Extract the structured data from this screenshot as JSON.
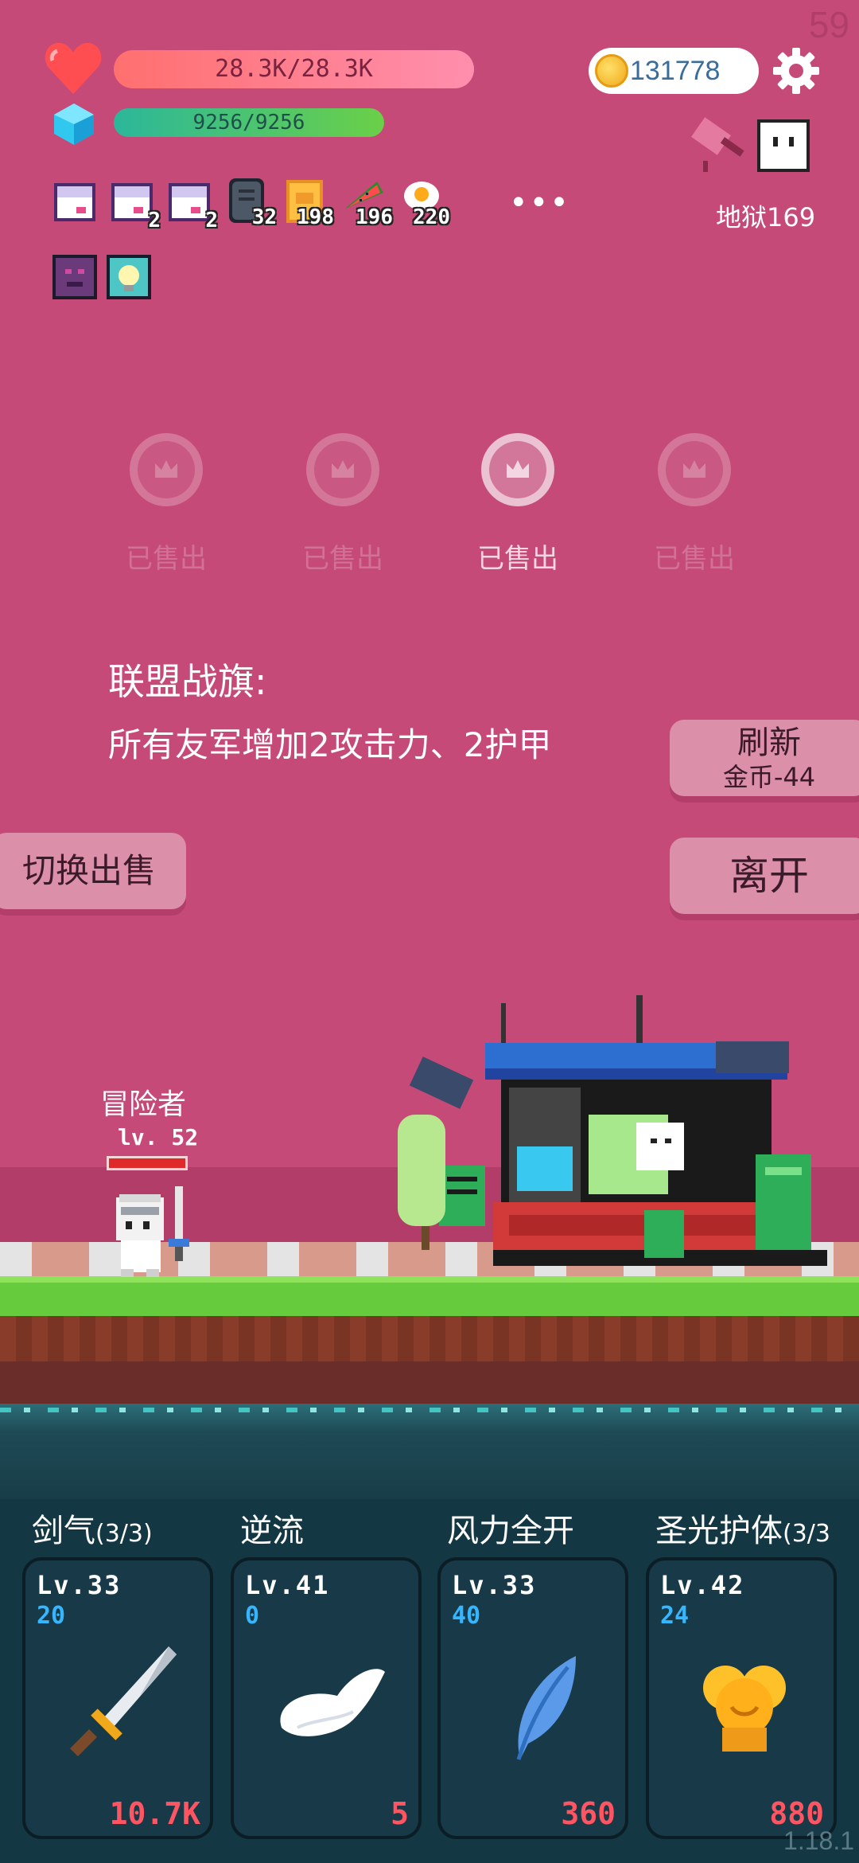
{
  "fps": "59",
  "stats": {
    "hp": "28.3K/28.3K",
    "mp": "9256/9256",
    "coins": "131778"
  },
  "location": "地狱169",
  "inventory": [
    {
      "icon": "mailbox-ribbon-icon",
      "count": ""
    },
    {
      "icon": "mailbox-ribbon-icon",
      "count": "2"
    },
    {
      "icon": "mailbox-ribbon-icon",
      "count": "2"
    },
    {
      "icon": "stone-tablet-icon",
      "count": "32"
    },
    {
      "icon": "spellbook-icon",
      "count": "198"
    },
    {
      "icon": "watermelon-icon",
      "count": "196"
    },
    {
      "icon": "fried-egg-icon",
      "count": "220"
    }
  ],
  "more_label": "•••",
  "buffs": [
    "demon-buff-icon",
    "lightbulb-buff-icon"
  ],
  "shop": {
    "slots": [
      {
        "label": "已售出",
        "active": false
      },
      {
        "label": "已售出",
        "active": false
      },
      {
        "label": "已售出",
        "active": true
      },
      {
        "label": "已售出",
        "active": false
      }
    ],
    "item_title": "联盟战旗:",
    "item_desc": "所有友军增加2攻击力、2护甲",
    "refresh_label": "刷新",
    "refresh_cost": "金币-44",
    "switch_label": "切换出售",
    "leave_label": "离开"
  },
  "player": {
    "name": "冒险者",
    "level": "lv. 52",
    "hp_fraction": 1.0
  },
  "skills": [
    {
      "name": "剑气",
      "count": "(3/3)",
      "level": "Lv.33",
      "value": "20",
      "cost": "10.7K",
      "icon": "sword-icon"
    },
    {
      "name": "逆流",
      "count": "",
      "level": "Lv.41",
      "value": "0",
      "cost": "5",
      "icon": "wing-icon"
    },
    {
      "name": "风力全开",
      "count": "",
      "level": "Lv.33",
      "value": "40",
      "cost": "360",
      "icon": "feather-icon"
    },
    {
      "name": "圣光护体",
      "count": "(3/3",
      "level": "Lv.42",
      "value": "24",
      "cost": "880",
      "icon": "golden-shield-icon"
    }
  ],
  "version": "1.18.1",
  "colors": {
    "background": "#c54a78",
    "hp_bar": "#ff7a8a",
    "mp_bar": "#3fc07a",
    "skill_value": "#35b6ff",
    "skill_cost": "#ff5562"
  }
}
